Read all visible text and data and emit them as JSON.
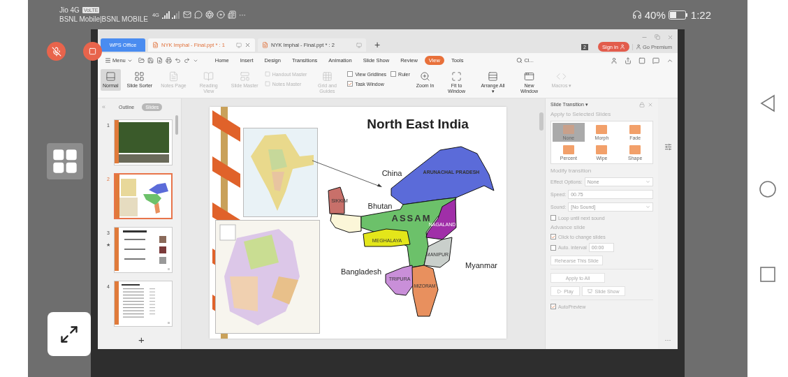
{
  "status_bar": {
    "carrier_1": "Jio 4G",
    "volte_badge": "VoLTE",
    "carrier_2": "BSNL Mobile|BSNL MOBILE",
    "network": "4G",
    "more": "···",
    "battery": "40%",
    "time": "1:22"
  },
  "window_tabs": [
    {
      "label": "WPS Office",
      "kind": "home",
      "selected": false
    },
    {
      "label": "NYK Imphal - Final.ppt * : 1",
      "kind": "doc",
      "selected": true
    },
    {
      "label": "NYK Imphal - Final.ppt * : 2",
      "kind": "doc",
      "selected": false
    }
  ],
  "new_tab": "+",
  "window_count": "2",
  "sign_in": "Sign in",
  "premium": "Go Premium",
  "menu": {
    "label": "Menu",
    "search": "Cl...",
    "tabs": [
      {
        "label": "Home",
        "selected": false
      },
      {
        "label": "Insert",
        "selected": false
      },
      {
        "label": "Design",
        "selected": false
      },
      {
        "label": "Transitions",
        "selected": false
      },
      {
        "label": "Animation",
        "selected": false
      },
      {
        "label": "Slide Show",
        "selected": false
      },
      {
        "label": "Review",
        "selected": false
      },
      {
        "label": "View",
        "selected": true
      },
      {
        "label": "Tools",
        "selected": false
      }
    ]
  },
  "ribbon": [
    {
      "kind": "large",
      "label": "Normal",
      "selected": true,
      "disabled": false
    },
    {
      "kind": "large",
      "label": "Slide Sorter",
      "selected": false,
      "disabled": false
    },
    {
      "kind": "large",
      "label": "Notes Page",
      "selected": false,
      "disabled": true
    },
    {
      "kind": "large",
      "label": "Reading View",
      "selected": false,
      "disabled": true
    },
    {
      "kind": "large",
      "label": "Slide Master",
      "selected": false,
      "disabled": true
    },
    {
      "kind": "stack",
      "items": [
        {
          "kind": "small",
          "label": "Handout Master",
          "disabled": true
        },
        {
          "kind": "small",
          "label": "Notes Master",
          "disabled": true
        }
      ]
    },
    {
      "kind": "large",
      "label": "Grid and Guides",
      "selected": false,
      "disabled": true
    },
    {
      "kind": "stack",
      "items": [
        {
          "kind": "check",
          "label": "View Gridlines",
          "checked": false
        },
        {
          "kind": "check",
          "label": "Task Window",
          "checked": true
        }
      ]
    },
    {
      "kind": "stack",
      "items": [
        {
          "kind": "check",
          "label": "Ruler",
          "checked": false
        }
      ]
    },
    {
      "kind": "large",
      "label": "Zoom In",
      "selected": false,
      "disabled": false
    },
    {
      "kind": "large",
      "label": "Fit to Window",
      "selected": false,
      "disabled": false
    },
    {
      "kind": "large",
      "label": "Arrange All ▾",
      "selected": false,
      "disabled": false
    },
    {
      "kind": "large",
      "label": "New Window",
      "selected": false,
      "disabled": false
    },
    {
      "kind": "large",
      "label": "Macros ▾",
      "selected": false,
      "disabled": true
    }
  ],
  "slides_panel": {
    "collapse": "«",
    "tabs": [
      {
        "label": "Outline",
        "selected": false
      },
      {
        "label": "Slides",
        "selected": true
      }
    ],
    "slides": [
      {
        "number": "1",
        "kind": "title",
        "selected": false
      },
      {
        "number": "2",
        "kind": "map",
        "selected": true
      },
      {
        "number": "3",
        "kind": "people",
        "selected": false,
        "marker": "★"
      },
      {
        "number": "4",
        "kind": "list",
        "selected": false
      }
    ],
    "add": "+"
  },
  "slide": {
    "title": "North East India",
    "states": [
      {
        "label": "ARUNACHAL PRADESH",
        "color": "#5b6bd9"
      },
      {
        "label": "SIKKIM",
        "color": "#c8706a"
      },
      {
        "label": "ASSAM",
        "color": "#6cc16a"
      },
      {
        "label": "NAGALAND",
        "color": "#a02fa8"
      },
      {
        "label": "MEGHALAYA",
        "color": "#e3e61a"
      },
      {
        "label": "MANIPUR",
        "color": "#c9cfcb"
      },
      {
        "label": "TRIPURA",
        "color": "#c98fd9"
      },
      {
        "label": "MIZORAM",
        "color": "#e8905e"
      }
    ],
    "neighbours": [
      {
        "label": "China"
      },
      {
        "label": "Bhutan"
      },
      {
        "label": "Bangladesh"
      },
      {
        "label": "Myanmar"
      }
    ]
  },
  "transition_pane": {
    "title": "Slide Transition ▾",
    "apply_heading": "Apply to Selected Slides",
    "effects": [
      {
        "label": "None",
        "selected": true
      },
      {
        "label": "Morph",
        "selected": false
      },
      {
        "label": "Fade",
        "selected": false
      },
      {
        "label": "Percent",
        "selected": false
      },
      {
        "label": "Wipe",
        "selected": false
      },
      {
        "label": "Shape",
        "selected": false
      }
    ],
    "modify_heading": "Modify transition",
    "effect_options": {
      "label": "Effect Options:",
      "value": "None"
    },
    "speed": {
      "label": "Speed:",
      "value": "00.75"
    },
    "sound": {
      "label": "Sound:",
      "value": "[No Sound]"
    },
    "loop": {
      "label": "Loop until next sound",
      "checked": false
    },
    "advance_heading": "Advance slide",
    "click": {
      "label": "Click to change slides",
      "checked": true
    },
    "auto": {
      "label": "Auto. interval",
      "checked": false,
      "value": "00:00"
    },
    "rehearse": "Rehearse This Slide",
    "apply_all": "Apply to All",
    "play": "Play",
    "slide_show": "Slide Show",
    "autopreview": {
      "label": "AutoPreview",
      "checked": true
    }
  },
  "side_strip": {
    "more": "···"
  }
}
